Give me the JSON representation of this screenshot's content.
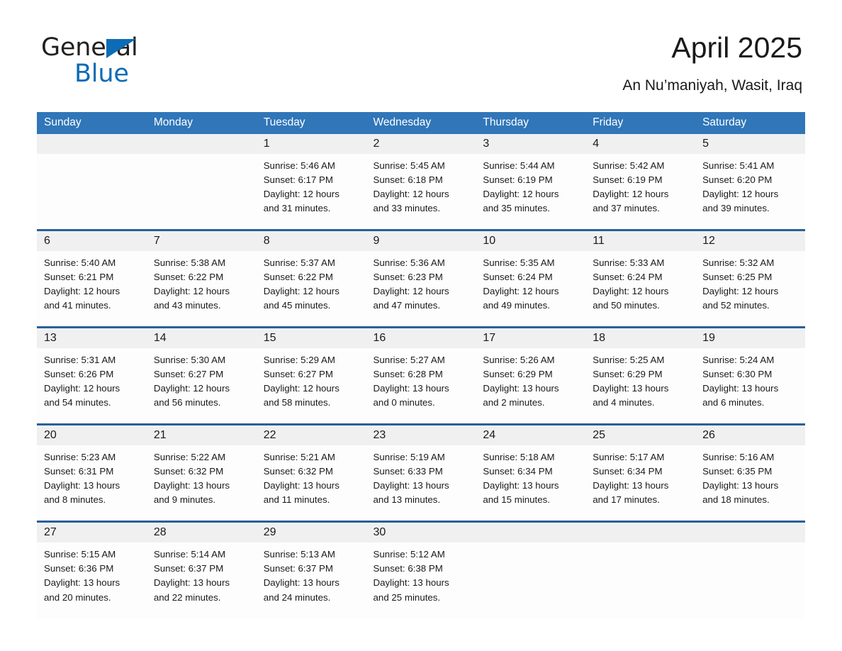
{
  "brand": {
    "name_part1": "General",
    "name_part2": "Blue",
    "triangle_color": "#0d6cb5"
  },
  "header": {
    "title": "April 2025",
    "location": "An Nu’maniyah, Wasit, Iraq"
  },
  "colors": {
    "header_blue": "#3076b8",
    "divider_blue": "#2a6099",
    "daynum_band": "#f0f0f0",
    "text": "#1a1a1a",
    "brand_blue": "#0d6cb5"
  },
  "weekday_headers": [
    "Sunday",
    "Monday",
    "Tuesday",
    "Wednesday",
    "Thursday",
    "Friday",
    "Saturday"
  ],
  "weeks": [
    [
      {
        "day": "",
        "sunrise": "",
        "sunset": "",
        "daylight1": "",
        "daylight2": ""
      },
      {
        "day": "",
        "sunrise": "",
        "sunset": "",
        "daylight1": "",
        "daylight2": ""
      },
      {
        "day": "1",
        "sunrise": "Sunrise: 5:46 AM",
        "sunset": "Sunset: 6:17 PM",
        "daylight1": "Daylight: 12 hours",
        "daylight2": "and 31 minutes."
      },
      {
        "day": "2",
        "sunrise": "Sunrise: 5:45 AM",
        "sunset": "Sunset: 6:18 PM",
        "daylight1": "Daylight: 12 hours",
        "daylight2": "and 33 minutes."
      },
      {
        "day": "3",
        "sunrise": "Sunrise: 5:44 AM",
        "sunset": "Sunset: 6:19 PM",
        "daylight1": "Daylight: 12 hours",
        "daylight2": "and 35 minutes."
      },
      {
        "day": "4",
        "sunrise": "Sunrise: 5:42 AM",
        "sunset": "Sunset: 6:19 PM",
        "daylight1": "Daylight: 12 hours",
        "daylight2": "and 37 minutes."
      },
      {
        "day": "5",
        "sunrise": "Sunrise: 5:41 AM",
        "sunset": "Sunset: 6:20 PM",
        "daylight1": "Daylight: 12 hours",
        "daylight2": "and 39 minutes."
      }
    ],
    [
      {
        "day": "6",
        "sunrise": "Sunrise: 5:40 AM",
        "sunset": "Sunset: 6:21 PM",
        "daylight1": "Daylight: 12 hours",
        "daylight2": "and 41 minutes."
      },
      {
        "day": "7",
        "sunrise": "Sunrise: 5:38 AM",
        "sunset": "Sunset: 6:22 PM",
        "daylight1": "Daylight: 12 hours",
        "daylight2": "and 43 minutes."
      },
      {
        "day": "8",
        "sunrise": "Sunrise: 5:37 AM",
        "sunset": "Sunset: 6:22 PM",
        "daylight1": "Daylight: 12 hours",
        "daylight2": "and 45 minutes."
      },
      {
        "day": "9",
        "sunrise": "Sunrise: 5:36 AM",
        "sunset": "Sunset: 6:23 PM",
        "daylight1": "Daylight: 12 hours",
        "daylight2": "and 47 minutes."
      },
      {
        "day": "10",
        "sunrise": "Sunrise: 5:35 AM",
        "sunset": "Sunset: 6:24 PM",
        "daylight1": "Daylight: 12 hours",
        "daylight2": "and 49 minutes."
      },
      {
        "day": "11",
        "sunrise": "Sunrise: 5:33 AM",
        "sunset": "Sunset: 6:24 PM",
        "daylight1": "Daylight: 12 hours",
        "daylight2": "and 50 minutes."
      },
      {
        "day": "12",
        "sunrise": "Sunrise: 5:32 AM",
        "sunset": "Sunset: 6:25 PM",
        "daylight1": "Daylight: 12 hours",
        "daylight2": "and 52 minutes."
      }
    ],
    [
      {
        "day": "13",
        "sunrise": "Sunrise: 5:31 AM",
        "sunset": "Sunset: 6:26 PM",
        "daylight1": "Daylight: 12 hours",
        "daylight2": "and 54 minutes."
      },
      {
        "day": "14",
        "sunrise": "Sunrise: 5:30 AM",
        "sunset": "Sunset: 6:27 PM",
        "daylight1": "Daylight: 12 hours",
        "daylight2": "and 56 minutes."
      },
      {
        "day": "15",
        "sunrise": "Sunrise: 5:29 AM",
        "sunset": "Sunset: 6:27 PM",
        "daylight1": "Daylight: 12 hours",
        "daylight2": "and 58 minutes."
      },
      {
        "day": "16",
        "sunrise": "Sunrise: 5:27 AM",
        "sunset": "Sunset: 6:28 PM",
        "daylight1": "Daylight: 13 hours",
        "daylight2": "and 0 minutes."
      },
      {
        "day": "17",
        "sunrise": "Sunrise: 5:26 AM",
        "sunset": "Sunset: 6:29 PM",
        "daylight1": "Daylight: 13 hours",
        "daylight2": "and 2 minutes."
      },
      {
        "day": "18",
        "sunrise": "Sunrise: 5:25 AM",
        "sunset": "Sunset: 6:29 PM",
        "daylight1": "Daylight: 13 hours",
        "daylight2": "and 4 minutes."
      },
      {
        "day": "19",
        "sunrise": "Sunrise: 5:24 AM",
        "sunset": "Sunset: 6:30 PM",
        "daylight1": "Daylight: 13 hours",
        "daylight2": "and 6 minutes."
      }
    ],
    [
      {
        "day": "20",
        "sunrise": "Sunrise: 5:23 AM",
        "sunset": "Sunset: 6:31 PM",
        "daylight1": "Daylight: 13 hours",
        "daylight2": "and 8 minutes."
      },
      {
        "day": "21",
        "sunrise": "Sunrise: 5:22 AM",
        "sunset": "Sunset: 6:32 PM",
        "daylight1": "Daylight: 13 hours",
        "daylight2": "and 9 minutes."
      },
      {
        "day": "22",
        "sunrise": "Sunrise: 5:21 AM",
        "sunset": "Sunset: 6:32 PM",
        "daylight1": "Daylight: 13 hours",
        "daylight2": "and 11 minutes."
      },
      {
        "day": "23",
        "sunrise": "Sunrise: 5:19 AM",
        "sunset": "Sunset: 6:33 PM",
        "daylight1": "Daylight: 13 hours",
        "daylight2": "and 13 minutes."
      },
      {
        "day": "24",
        "sunrise": "Sunrise: 5:18 AM",
        "sunset": "Sunset: 6:34 PM",
        "daylight1": "Daylight: 13 hours",
        "daylight2": "and 15 minutes."
      },
      {
        "day": "25",
        "sunrise": "Sunrise: 5:17 AM",
        "sunset": "Sunset: 6:34 PM",
        "daylight1": "Daylight: 13 hours",
        "daylight2": "and 17 minutes."
      },
      {
        "day": "26",
        "sunrise": "Sunrise: 5:16 AM",
        "sunset": "Sunset: 6:35 PM",
        "daylight1": "Daylight: 13 hours",
        "daylight2": "and 18 minutes."
      }
    ],
    [
      {
        "day": "27",
        "sunrise": "Sunrise: 5:15 AM",
        "sunset": "Sunset: 6:36 PM",
        "daylight1": "Daylight: 13 hours",
        "daylight2": "and 20 minutes."
      },
      {
        "day": "28",
        "sunrise": "Sunrise: 5:14 AM",
        "sunset": "Sunset: 6:37 PM",
        "daylight1": "Daylight: 13 hours",
        "daylight2": "and 22 minutes."
      },
      {
        "day": "29",
        "sunrise": "Sunrise: 5:13 AM",
        "sunset": "Sunset: 6:37 PM",
        "daylight1": "Daylight: 13 hours",
        "daylight2": "and 24 minutes."
      },
      {
        "day": "30",
        "sunrise": "Sunrise: 5:12 AM",
        "sunset": "Sunset: 6:38 PM",
        "daylight1": "Daylight: 13 hours",
        "daylight2": "and 25 minutes."
      },
      {
        "day": "",
        "sunrise": "",
        "sunset": "",
        "daylight1": "",
        "daylight2": ""
      },
      {
        "day": "",
        "sunrise": "",
        "sunset": "",
        "daylight1": "",
        "daylight2": ""
      },
      {
        "day": "",
        "sunrise": "",
        "sunset": "",
        "daylight1": "",
        "daylight2": ""
      }
    ]
  ]
}
